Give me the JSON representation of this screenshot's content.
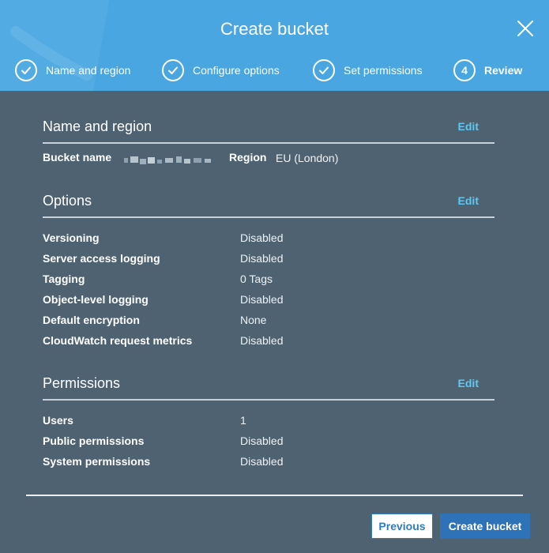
{
  "dialog": {
    "title": "Create bucket"
  },
  "steps": [
    {
      "label": "Name and region",
      "state": "done"
    },
    {
      "label": "Configure options",
      "state": "done"
    },
    {
      "label": "Set permissions",
      "state": "done"
    },
    {
      "label": "Review",
      "state": "active",
      "number": "4"
    }
  ],
  "sections": {
    "name_region": {
      "title": "Name and region",
      "edit": "Edit",
      "bucket_name_label": "Bucket name",
      "region_label": "Region",
      "region_value": "EU (London)"
    },
    "options": {
      "title": "Options",
      "edit": "Edit",
      "rows": [
        {
          "label": "Versioning",
          "value": "Disabled"
        },
        {
          "label": "Server access logging",
          "value": "Disabled"
        },
        {
          "label": "Tagging",
          "value": "0 Tags"
        },
        {
          "label": "Object-level logging",
          "value": "Disabled"
        },
        {
          "label": "Default encryption",
          "value": "None"
        },
        {
          "label": "CloudWatch request metrics",
          "value": "Disabled"
        }
      ]
    },
    "permissions": {
      "title": "Permissions",
      "edit": "Edit",
      "rows": [
        {
          "label": "Users",
          "value": "1"
        },
        {
          "label": "Public permissions",
          "value": "Disabled"
        },
        {
          "label": "System permissions",
          "value": "Disabled"
        }
      ]
    }
  },
  "footer": {
    "previous_label": "Previous",
    "create_label": "Create bucket"
  },
  "colors": {
    "header": "#49a6e0",
    "body": "#4f6272",
    "link": "#5ec8f2",
    "primary": "#2e73b8"
  }
}
